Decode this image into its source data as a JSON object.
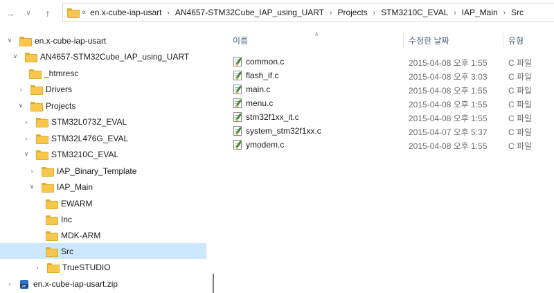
{
  "address": {
    "overflow_glyph": "«",
    "crumbs": [
      "en.x-cube-iap-usart",
      "AN4657-STM32Cube_IAP_using_UART",
      "Projects",
      "STM3210C_EVAL",
      "IAP_Main",
      "Src"
    ]
  },
  "tree": {
    "items": [
      {
        "label": "en.x-cube-iap-usart",
        "chevron": "v"
      },
      {
        "label": "AN4657-STM32Cube_IAP_using_UART",
        "chevron": "v"
      },
      {
        "label": "_htmresc",
        "chevron": ""
      },
      {
        "label": "Drivers",
        "chevron": ">"
      },
      {
        "label": "Projects",
        "chevron": "v"
      },
      {
        "label": "STM32L073Z_EVAL",
        "chevron": ">"
      },
      {
        "label": "STM32L476G_EVAL",
        "chevron": ">"
      },
      {
        "label": "STM3210C_EVAL",
        "chevron": "v"
      },
      {
        "label": "IAP_Binary_Template",
        "chevron": ">"
      },
      {
        "label": "IAP_Main",
        "chevron": "v"
      },
      {
        "label": "EWARM",
        "chevron": ""
      },
      {
        "label": "Inc",
        "chevron": ""
      },
      {
        "label": "MDK-ARM",
        "chevron": ""
      },
      {
        "label": "Src",
        "chevron": ""
      },
      {
        "label": "TrueSTUDIO",
        "chevron": ">"
      },
      {
        "label": "en.x-cube-iap-usart.zip",
        "chevron": ">"
      }
    ],
    "selected": "Src",
    "zip_badge": "ZIP"
  },
  "files": {
    "headers": {
      "name": "이름",
      "date": "수정한 날짜",
      "type": "유형"
    },
    "rows": [
      {
        "name": "common.c",
        "date": "2015-04-08 오후 1:55",
        "type": "C 파일"
      },
      {
        "name": "flash_if.c",
        "date": "2015-04-08 오후 3:03",
        "type": "C 파일"
      },
      {
        "name": "main.c",
        "date": "2015-04-08 오후 1:55",
        "type": "C 파일"
      },
      {
        "name": "menu.c",
        "date": "2015-04-08 오후 1:55",
        "type": "C 파일"
      },
      {
        "name": "stm32f1xx_it.c",
        "date": "2015-04-08 오후 1:55",
        "type": "C 파일"
      },
      {
        "name": "system_stm32f1xx.c",
        "date": "2015-04-07 오후 5:37",
        "type": "C 파일"
      },
      {
        "name": "ymodem.c",
        "date": "2015-04-08 오후 1:55",
        "type": "C 파일"
      }
    ]
  },
  "colors": {
    "selection": "#cce8ff",
    "folder": "#f7c64d",
    "header_text": "#4c607a"
  }
}
